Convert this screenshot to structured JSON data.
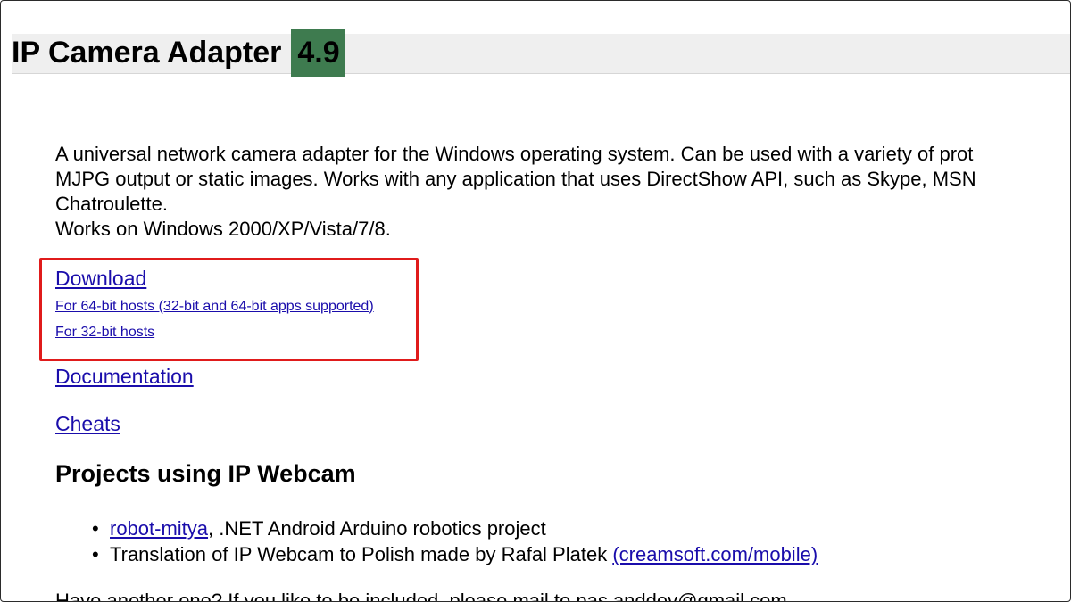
{
  "header": {
    "title": "IP Camera Adapter",
    "version": "4.9"
  },
  "description": {
    "lines": [
      "A universal network camera adapter for the Windows operating system. Can be used with a variety of prot",
      "MJPG output or static images. Works with any application that uses DirectShow API, such as Skype, MSN",
      "Chatroulette.",
      "Works on Windows 2000/XP/Vista/7/8."
    ]
  },
  "download": {
    "label": "Download",
    "links": [
      "For 64-bit hosts (32-bit and 64-bit apps supported)",
      "For 32-bit hosts"
    ],
    "highlight_color": "#e01b1b"
  },
  "links": {
    "documentation": "Documentation",
    "cheats": "Cheats"
  },
  "projects": {
    "heading": "Projects using IP Webcam",
    "items": [
      {
        "link": "robot-mitya",
        "text": ", .NET Android Arduino robotics project"
      },
      {
        "text": "Translation of IP Webcam to Polish made by Rafal Platek ",
        "link": "(creamsoft.com/mobile)"
      }
    ]
  },
  "footer": {
    "text": "Have another one? If you like to be included, please mail to pas.anddev@gmail.com"
  },
  "colors": {
    "badge": "#3e7b4f",
    "link": "#1a0dab",
    "header_band": "#efefef"
  }
}
